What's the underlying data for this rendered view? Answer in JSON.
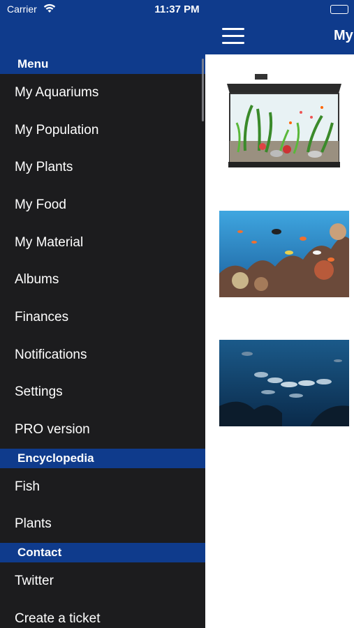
{
  "status": {
    "carrier": "Carrier",
    "time": "11:37 PM"
  },
  "header": {
    "title": "My"
  },
  "drawer": {
    "sections": [
      {
        "header": "Menu",
        "items": [
          "My Aquariums",
          "My Population",
          "My Plants",
          "My Food",
          "My Material",
          "Albums",
          "Finances",
          "Notifications",
          "Settings",
          "PRO version"
        ]
      },
      {
        "header": "Encyclopedia",
        "items": [
          "Fish",
          "Plants"
        ]
      },
      {
        "header": "Contact",
        "items": [
          "Twitter",
          "Create a ticket"
        ]
      }
    ]
  },
  "colors": {
    "accent": "#0f3b8c",
    "drawer_bg": "#1c1c1e"
  }
}
